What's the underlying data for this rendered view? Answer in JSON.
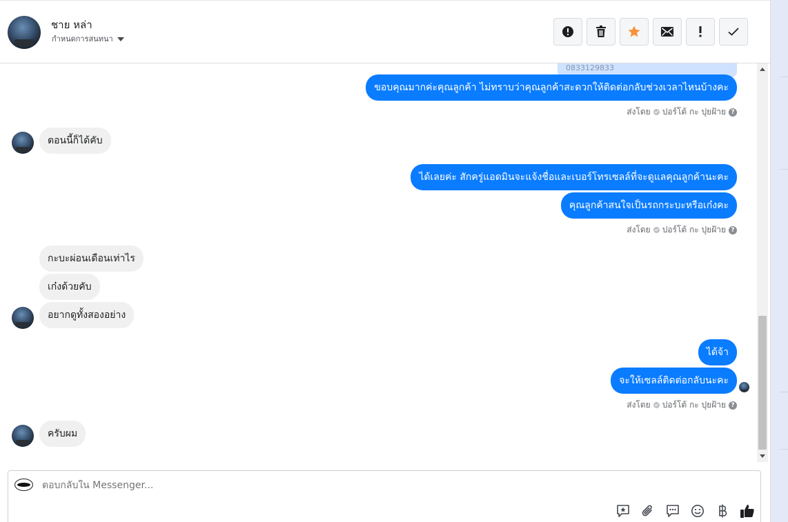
{
  "header": {
    "name": "ชาย หล่า",
    "subtitle": "กำหนดการสนทนา",
    "tools": [
      {
        "name": "report-icon",
        "glyph": "!"
      },
      {
        "name": "trash-icon",
        "glyph": "🗑"
      },
      {
        "name": "star-icon",
        "glyph": "★"
      },
      {
        "name": "mail-icon",
        "glyph": "✉"
      },
      {
        "name": "exclamation-icon",
        "glyph": "!"
      },
      {
        "name": "check-icon",
        "glyph": "✓"
      }
    ]
  },
  "conversation": {
    "clipped_card_text": "0833129833",
    "out_msg_1": "ขอบคุณมากค่ะคุณลูกค้า ไม่ทราบว่าคุณลูกค้าสะดวกให้ติดต่อกลับช่วงเวลาไหนบ้างคะ",
    "in_msg_1": "ตอนนี้ก็ได้คับ",
    "out_msg_2": "ได้เลยค่ะ สักครู่แอดมินจะแจ้งชื่อและเบอร์โทรเซลล์ที่จะดูแลคุณลูกค้านะคะ",
    "out_msg_3": "คุณลูกค้าสนใจเป็นรถกระบะหรือเก๋งคะ",
    "in_msg_2": "กะบะผ่อนเดือนเท่าไร",
    "in_msg_3": "เก๋งด้วยคับ",
    "in_msg_4": "อยากดูทั้งสองอย่าง",
    "out_msg_4": "ได้จ้า",
    "out_msg_5": "จะให้เซลล์ติดต่อกลับนะคะ",
    "in_msg_5": "ครับผม",
    "sent_by_label": "ส่งโดย",
    "sent_by_name": "ปอร์โต้ กะ ปุยฝ้าย"
  },
  "composer": {
    "placeholder": "ตอบกลับใน Messenger...",
    "icons": [
      "quick-reply-icon",
      "attachment-icon",
      "saved-replies-icon",
      "emoji-icon",
      "baht-icon",
      "thumbs-up-icon"
    ]
  },
  "colors": {
    "outgoing_bubble": "#0a7cff",
    "incoming_bubble": "#f0f0f0",
    "star": "#f7923a"
  }
}
